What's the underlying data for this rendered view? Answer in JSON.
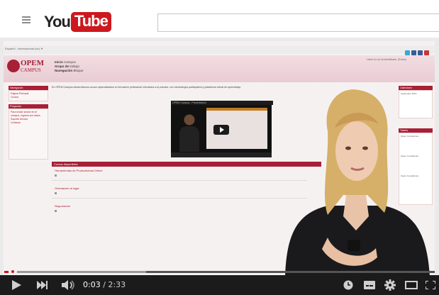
{
  "youtube": {
    "logo_you": "You",
    "logo_tube": "Tube",
    "search_value": ""
  },
  "video_content": {
    "breadcrumb": "Español - Internacional (es) ▼",
    "logo_main": "OPEM",
    "logo_sub": "CAMPUS",
    "header_nav": [
      {
        "label": "Inicio",
        "value": "Campus"
      },
      {
        "label": "Grupo de",
        "value": "trabajo"
      },
      {
        "label": "Navegación",
        "value": "Bloque"
      }
    ],
    "header_right": "Usted no se ha identificado. (Entrar)",
    "left_blocks": [
      {
        "title": "Navegación",
        "lines": [
          "Página Principal",
          "Cursos"
        ]
      },
      {
        "title": "Preguntas",
        "lines": [
          "Para iniciar sesión en el campus, ingrese sus datos.",
          "Soporte técnico",
          "Contacto"
        ]
      }
    ],
    "intro_text": "En OPEM Campus desarrollamos cursos especializados en formación profesional orientados a la práctica, con metodología participativa y plataforma virtual de aprendizaje.",
    "inner_video_title": "OPEM Campus - Presentación",
    "section_title": "Cursos disponibles",
    "courses": [
      "Herramientas de Productividad Online",
      "Orientación al lugar",
      "Negociación"
    ],
    "right_blocks": [
      {
        "title": "Calendario",
        "lines": [
          "septiembre 2013"
        ]
      },
      {
        "title": "Tweets",
        "lines": [
          "Opem Consultores",
          "Opem Consultores",
          "Opem Consultores"
        ]
      }
    ]
  },
  "player": {
    "current_time": "0:03",
    "separator": " / ",
    "duration": "2:33",
    "progress_played": 0.02,
    "progress_loaded": 0.33
  },
  "colors": {
    "brand_red": "#cc181e",
    "opem_burgundy": "#a72036",
    "control_bar": "#1b1b1b"
  }
}
